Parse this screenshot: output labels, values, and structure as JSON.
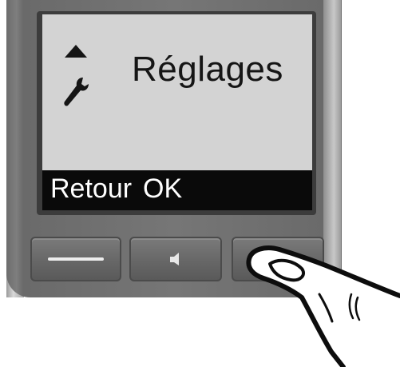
{
  "screen": {
    "title": "Réglages",
    "nav_icon": "arrow-up-icon",
    "menu_icon": "wrench-icon"
  },
  "softkeys": {
    "left_label": "Retour",
    "right_label": "OK"
  },
  "hardware_keys": [
    {
      "name": "left-softkey-button",
      "icon": "line-icon"
    },
    {
      "name": "handsfree-button",
      "icon": "speaker-icon"
    },
    {
      "name": "right-softkey-button",
      "icon": ""
    }
  ],
  "colors": {
    "bezel": "#767676",
    "lcd_background": "#d3d3d3",
    "lcd_text": "#151515",
    "softkey_bar": "#0a0a0a",
    "softkey_text": "#ffffff"
  }
}
